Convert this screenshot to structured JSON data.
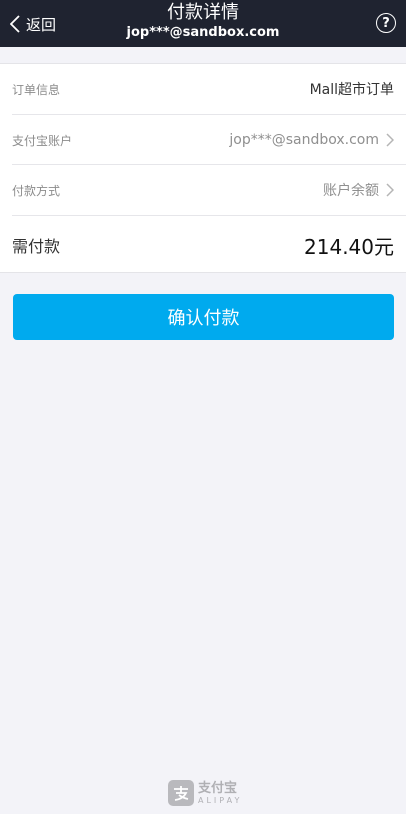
{
  "header": {
    "back_label": "返回",
    "title": "付款详情",
    "subtitle": "jop***@sandbox.com",
    "help_label": "?"
  },
  "details": {
    "order_info": {
      "label": "订单信息",
      "value": "Mall超市订单"
    },
    "alipay_account": {
      "label": "支付宝账户",
      "value": "jop***@sandbox.com"
    },
    "payment_method": {
      "label": "付款方式",
      "value": "账户余额"
    },
    "amount_due": {
      "label": "需付款",
      "value": "214.40元"
    }
  },
  "confirm_button": "确认付款",
  "footer": {
    "logo_cn": "支付宝",
    "logo_en": "ALIPAY"
  },
  "colors": {
    "header_bg": "#1f2330",
    "accent": "#00aaee",
    "page_bg": "#f3f3f8"
  }
}
